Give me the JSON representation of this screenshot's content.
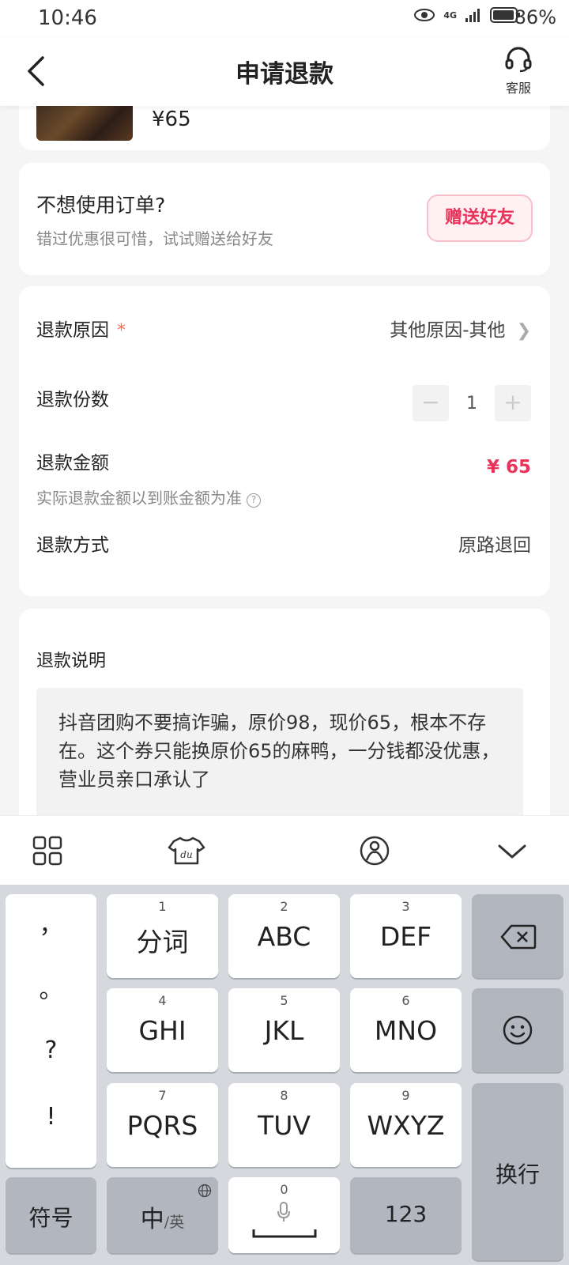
{
  "status_bar": {
    "time": "10:46",
    "network": "4G",
    "battery": "86%"
  },
  "header": {
    "title": "申请退款",
    "service_label": "客服"
  },
  "product": {
    "price": "¥65"
  },
  "gift": {
    "title": "不想使用订单?",
    "subtitle": "错过优惠很可惜，试试赠送给好友",
    "button": "赠送好友"
  },
  "form": {
    "reason_label": "退款原因",
    "required_mark": "*",
    "reason_value": "其他原因-其他",
    "count_label": "退款份数",
    "count_value": "1",
    "minus": "−",
    "plus": "+",
    "amount_label": "退款金额",
    "amount_value": "¥ 65",
    "amount_hint": "实际退款金额以到账金额为准",
    "method_label": "退款方式",
    "method_value": "原路退回"
  },
  "description": {
    "label": "退款说明",
    "text": "抖音团购不要搞诈骗，原价98，现价65，根本不存在。这个券只能换原价65的麻鸭，一分钱都没优惠，营业员亲口承认了"
  },
  "keyboard": {
    "punctuation": [
      "，",
      "。",
      "?",
      "!"
    ],
    "keys": [
      {
        "num": "1",
        "label": "分词"
      },
      {
        "num": "2",
        "label": "ABC"
      },
      {
        "num": "3",
        "label": "DEF"
      },
      {
        "num": "4",
        "label": "GHI"
      },
      {
        "num": "5",
        "label": "JKL"
      },
      {
        "num": "6",
        "label": "MNO"
      },
      {
        "num": "7",
        "label": "PQRS"
      },
      {
        "num": "8",
        "label": "TUV"
      },
      {
        "num": "9",
        "label": "WXYZ"
      }
    ],
    "symbols": "符号",
    "lang_main": "中",
    "lang_alt": "/英",
    "space_num": "0",
    "num_mode": "123",
    "enter": "换行"
  }
}
